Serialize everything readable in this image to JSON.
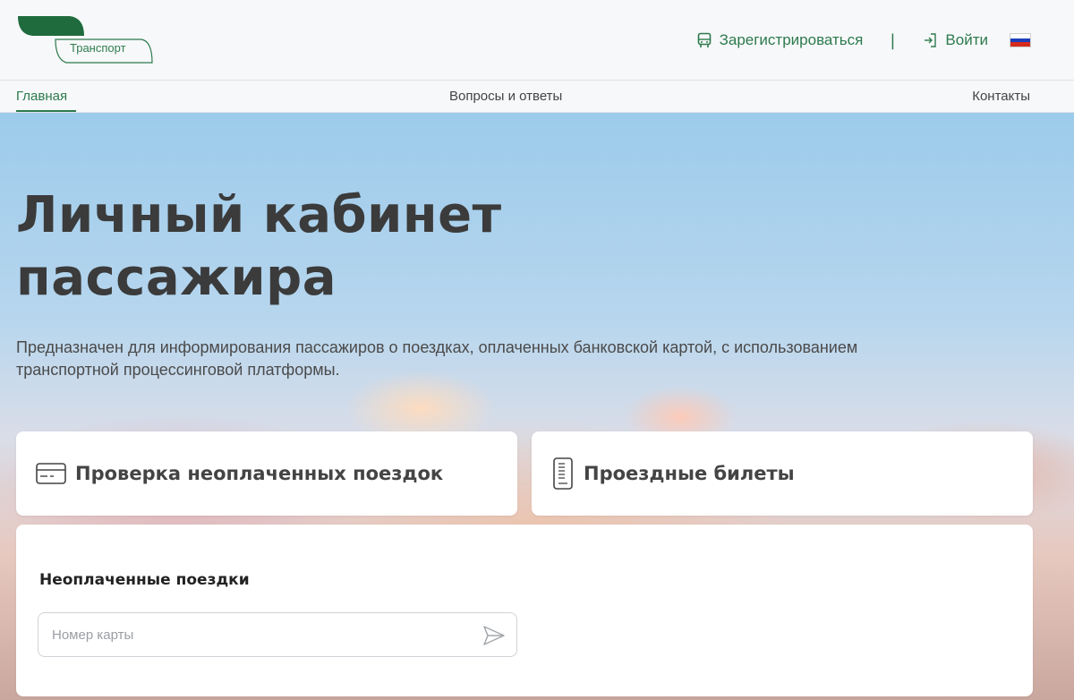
{
  "header": {
    "logo_text": "Транспорт",
    "register_label": "Зарегистрироваться",
    "separator": "|",
    "login_label": "Войти",
    "language_flag": "ru-flag-icon"
  },
  "nav": {
    "items": [
      {
        "label": "Главная",
        "active": true
      },
      {
        "label": "Вопросы и ответы",
        "active": false
      },
      {
        "label": "Контакты",
        "active": false
      }
    ]
  },
  "hero": {
    "title_line1": "Личный кабинет",
    "title_line2": "пассажира",
    "subtitle": "Предназначен для информирования пассажиров о поездках, оплаченных банковской картой, с использованием транспортной процессинговой платформы."
  },
  "tabs": [
    {
      "label": "Проверка неоплаченных поездок",
      "icon": "card-icon"
    },
    {
      "label": "Проездные билеты",
      "icon": "ticket-icon"
    }
  ],
  "panel": {
    "title": "Неоплаченные поездки",
    "input_placeholder": "Номер карты",
    "input_value": "",
    "submit_icon": "send-icon"
  },
  "colors": {
    "accent": "#2d7a4e",
    "logo_leaf": "#1f6b3e"
  }
}
